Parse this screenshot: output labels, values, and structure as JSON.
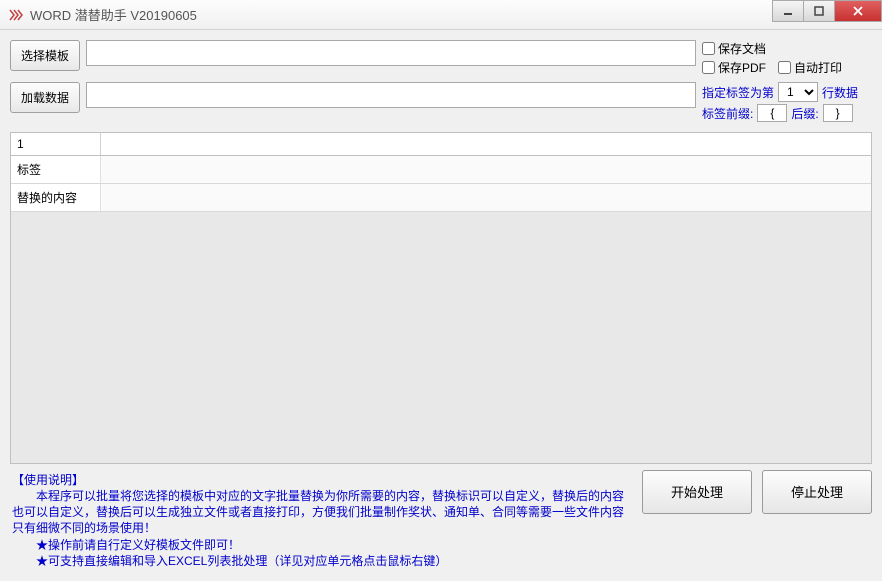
{
  "window": {
    "title": "WORD 潜替助手 V20190605"
  },
  "toolbar": {
    "select_template_btn": "选择模板",
    "load_data_btn": "加载数据"
  },
  "inputs": {
    "template_path": "",
    "data_path": ""
  },
  "options": {
    "save_doc_label": "保存文档",
    "save_pdf_label": "保存PDF",
    "auto_print_label": "自动打印",
    "specify_tag_label": "指定标签为第",
    "row_data_label": "行数据",
    "tag_row_value": "1",
    "tag_prefix_label": "标签前缀:",
    "tag_prefix_value": "{",
    "tag_suffix_label": "后缀:",
    "tag_suffix_value": "}"
  },
  "grid": {
    "col1_header": "1",
    "row_labels": [
      "标签",
      "替换的内容"
    ]
  },
  "help": {
    "title": "【使用说明】",
    "line1": "　　本程序可以批量将您选择的模板中对应的文字批量替换为你所需要的内容，替换标识可以自定义，替换后的内容也可以自定义，替换后可以生成独立文件或者直接打印，方便我们批量制作奖状、通知单、合同等需要一些文件内容只有细微不同的场景使用！",
    "line2": "　　★操作前请自行定义好模板文件即可！",
    "line3": "　　★可支持直接编辑和导入EXCEL列表批处理（详见对应单元格点击鼠标右键）"
  },
  "actions": {
    "start_btn": "开始处理",
    "stop_btn": "停止处理"
  }
}
